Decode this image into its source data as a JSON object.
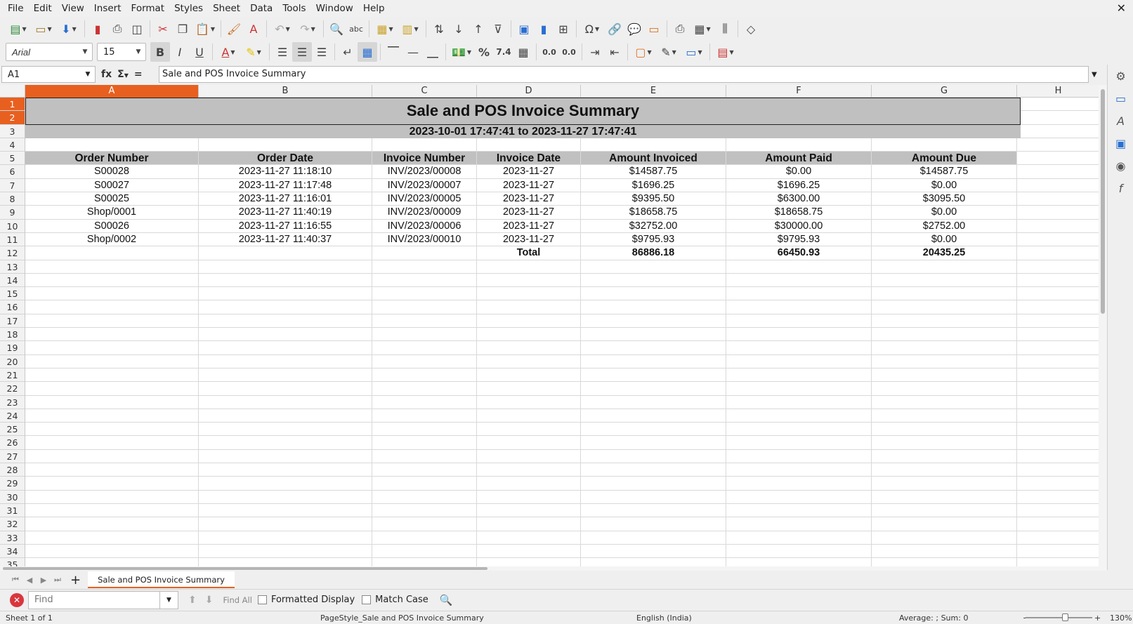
{
  "menu": [
    "File",
    "Edit",
    "View",
    "Insert",
    "Format",
    "Styles",
    "Sheet",
    "Data",
    "Tools",
    "Window",
    "Help"
  ],
  "font": {
    "name": "Arial",
    "size": "15"
  },
  "name_box": "A1",
  "formula": "Sale and POS Invoice Summary",
  "columns": [
    "A",
    "B",
    "C",
    "D",
    "E",
    "F",
    "G",
    "H"
  ],
  "rows": [
    "1",
    "2",
    "3",
    "4",
    "5",
    "6",
    "7",
    "8",
    "9",
    "10",
    "11",
    "12",
    "13",
    "14",
    "15",
    "16",
    "17",
    "18",
    "19",
    "20",
    "21",
    "22",
    "23",
    "24",
    "25",
    "26",
    "27",
    "28",
    "29",
    "30",
    "31",
    "32",
    "33",
    "34",
    "35"
  ],
  "sheet": {
    "title": "Sale and POS Invoice Summary",
    "subtitle": "2023-10-01 17:47:41 to 2023-11-27 17:47:41",
    "headers": [
      "Order Number",
      "Order Date",
      "Invoice Number",
      "Invoice Date",
      "Amount Invoiced",
      "Amount Paid",
      "Amount Due"
    ],
    "data": [
      [
        "S00028",
        "2023-11-27 11:18:10",
        "INV/2023/00008",
        "2023-11-27",
        "$14587.75",
        "$0.00",
        "$14587.75"
      ],
      [
        "S00027",
        "2023-11-27 11:17:48",
        "INV/2023/00007",
        "2023-11-27",
        "$1696.25",
        "$1696.25",
        "$0.00"
      ],
      [
        "S00025",
        "2023-11-27 11:16:01",
        "INV/2023/00005",
        "2023-11-27",
        "$9395.50",
        "$6300.00",
        "$3095.50"
      ],
      [
        "Shop/0001",
        "2023-11-27 11:40:19",
        "INV/2023/00009",
        "2023-11-27",
        "$18658.75",
        "$18658.75",
        "$0.00"
      ],
      [
        "S00026",
        "2023-11-27 11:16:55",
        "INV/2023/00006",
        "2023-11-27",
        "$32752.00",
        "$30000.00",
        "$2752.00"
      ],
      [
        "Shop/0002",
        "2023-11-27 11:40:37",
        "INV/2023/00010",
        "2023-11-27",
        "$9795.93",
        "$9795.93",
        "$0.00"
      ]
    ],
    "total_label": "Total",
    "totals": [
      "86886.18",
      "66450.93",
      "20435.25"
    ]
  },
  "sheet_tab": "Sale and POS Invoice Summary",
  "find": {
    "placeholder": "Find",
    "find_all": "Find All",
    "formatted_display": "Formatted Display",
    "match_case": "Match Case"
  },
  "status": {
    "sheet": "Sheet 1 of 1",
    "page_style": "PageStyle_Sale and POS Invoice Summary",
    "language": "English (India)",
    "summary": "Average: ; Sum: 0",
    "zoom": "130%"
  }
}
